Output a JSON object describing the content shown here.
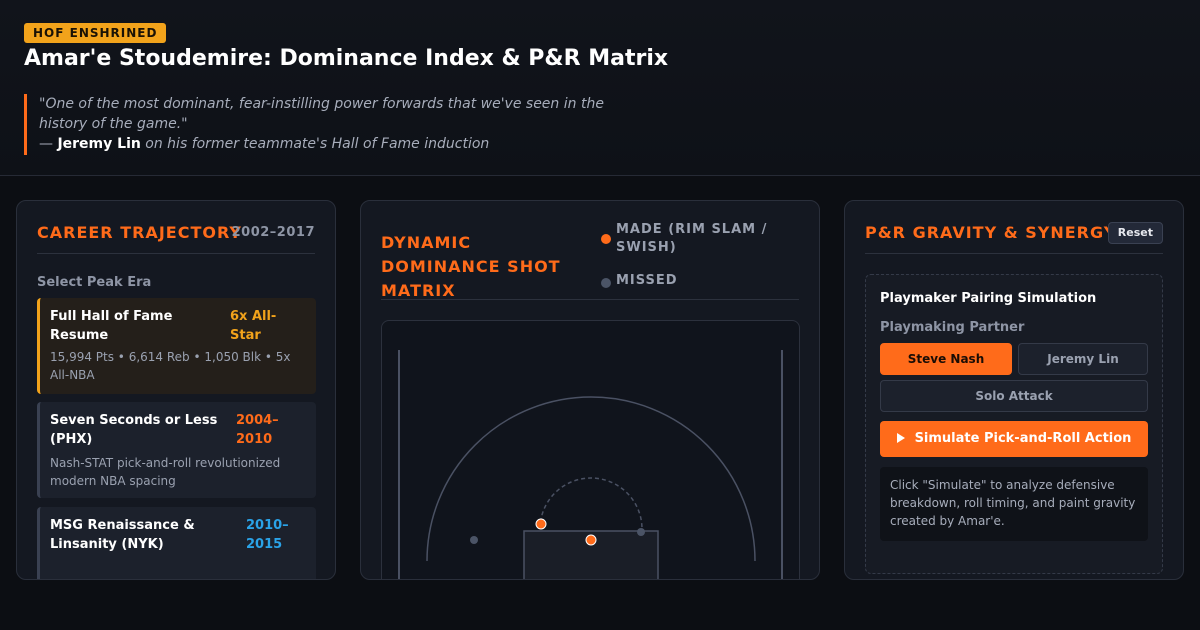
{
  "header": {
    "badge": "HOF ENSHRINED",
    "title": "Amar'e Stoudemire: Dominance Index & P&R Matrix",
    "quote_line1": "\"One of the most dominant, fear-instilling power forwards that we've seen in the",
    "quote_line2": "history of the game.\"",
    "attr_dash": "— ",
    "attr_name": "Jeremy Lin",
    "attr_context": " on his former teammate's Hall of Fame induction"
  },
  "career": {
    "title": "CAREER TRAJECTORY",
    "years": "2002–2017",
    "select_label": "Select Peak Era",
    "eras": [
      {
        "name": "Full Hall of Fame Resume",
        "tag": "6x All-Star",
        "desc": "15,994 Pts • 6,614 Reb • 1,050 Blk • 5x All-NBA"
      },
      {
        "name": "Seven Seconds or Less (PHX)",
        "tag": "2004–2010",
        "desc": "Nash-STAT pick-and-roll revolutionized modern NBA spacing"
      },
      {
        "name": "MSG Renaissance & Linsanity (NYK)",
        "tag": "2010–2015",
        "desc": ""
      }
    ]
  },
  "matrix": {
    "title": "DYNAMIC DOMINANCE SHOT MATRIX",
    "legend_made": "MADE (RIM SLAM / SWISH)",
    "legend_missed": "MISSED",
    "colors": {
      "made": "#ff6b1a",
      "missed": "#4b5466"
    }
  },
  "pnr": {
    "title": "P&R GRAVITY & SYNERGY",
    "reset_label": "Reset",
    "sim_title": "Playmaker Pairing Simulation",
    "partner_label": "Playmaking Partner",
    "options": [
      "Steve Nash",
      "Jeremy Lin",
      "Solo Attack"
    ],
    "selected": "Steve Nash",
    "simulate_label": "Simulate Pick-and-Roll Action",
    "output": "Click \"Simulate\" to analyze defensive breakdown, roll timing, and paint gravity created by Amar'e."
  }
}
